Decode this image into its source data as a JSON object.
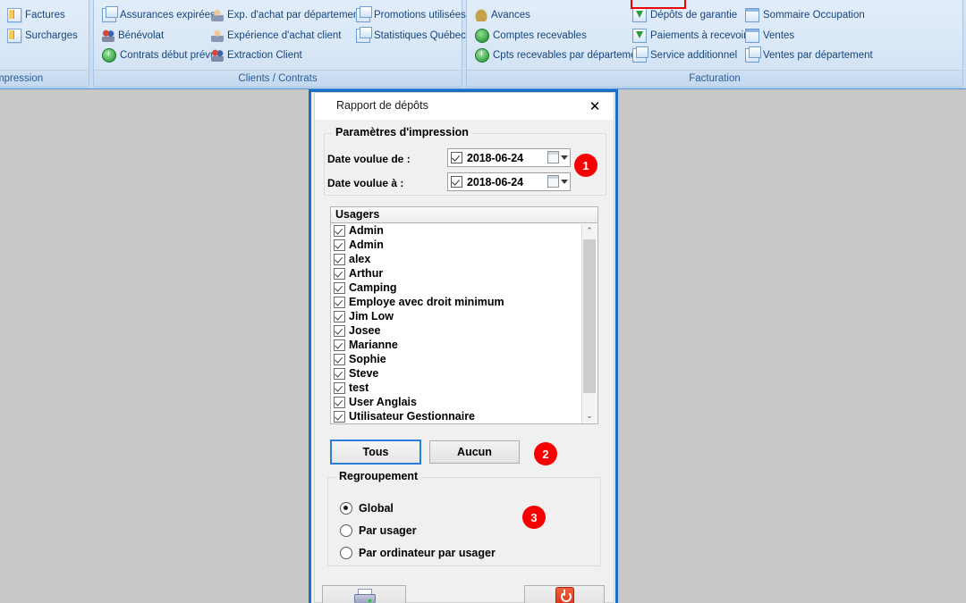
{
  "ribbon": {
    "groups": [
      {
        "name": "Impression",
        "items": [
          {
            "label": "Factures",
            "icon": "document-icon"
          },
          {
            "label": "Surcharges",
            "icon": "document-icon"
          }
        ]
      },
      {
        "name": "Clients / Contrats",
        "items": [
          {
            "label": "Assurances expirées",
            "icon": "window-stack-icon"
          },
          {
            "label": "Bénévolat",
            "icon": "people-icon"
          },
          {
            "label": "Contrats début prévu",
            "icon": "contract-icon"
          },
          {
            "label": "Exp. d'achat par département",
            "icon": "person-icon"
          },
          {
            "label": "Expérience d'achat client",
            "icon": "person-icon"
          },
          {
            "label": "Extraction Client",
            "icon": "people-icon"
          },
          {
            "label": "Promotions utilisées",
            "icon": "window-stack-icon"
          },
          {
            "label": "Statistiques Québec",
            "icon": "window-stack-icon"
          }
        ]
      },
      {
        "name": "Facturation",
        "items": [
          {
            "label": "Avances",
            "icon": "money-bag-icon"
          },
          {
            "label": "Comptes recevables",
            "icon": "green-coin-icon"
          },
          {
            "label": "Cpts recevables par département",
            "icon": "green-clock-icon"
          },
          {
            "label": "Dépôts de garantie",
            "icon": "download-window-icon"
          },
          {
            "label": "Paiements à recevoir",
            "icon": "download-window-icon"
          },
          {
            "label": "Service additionnel",
            "icon": "window-stack-icon"
          },
          {
            "label": "Sommaire Occupation",
            "icon": "window-icon"
          },
          {
            "label": "Ventes",
            "icon": "window-icon"
          },
          {
            "label": "Ventes par département",
            "icon": "window-stack-icon"
          }
        ]
      }
    ],
    "highlight_color": "#ee0000"
  },
  "dialog": {
    "title": "Rapport de dépôts",
    "close_label": "✕",
    "print_params": {
      "legend": "Paramètres d'impression",
      "date_from_label": "Date voulue de :",
      "date_from_value": "2018-06-24",
      "date_to_label": "Date voulue à :",
      "date_to_value": "2018-06-24"
    },
    "users_list": {
      "header": "Usagers",
      "items": [
        "Admin",
        "Admin",
        "alex",
        "Arthur",
        "Camping",
        "Employe avec droit minimum",
        "Jim Low",
        "Josee",
        "Marianne",
        "Sophie",
        "Steve",
        "test",
        "User Anglais",
        "Utilisateur Gestionnaire"
      ],
      "scroll_up": "⌃",
      "scroll_down": "⌄"
    },
    "select_buttons": {
      "all_label": "Tous",
      "none_label": "Aucun"
    },
    "grouping": {
      "legend": "Regroupement",
      "options": [
        {
          "label": "Global",
          "selected": true
        },
        {
          "label": "Par usager",
          "selected": false
        },
        {
          "label": "Par ordinateur par usager",
          "selected": false
        }
      ]
    },
    "actions": {
      "print_icon": "printer-icon",
      "exit_icon": "power-icon"
    },
    "badges": [
      {
        "number": "1"
      },
      {
        "number": "2"
      },
      {
        "number": "3"
      }
    ],
    "badge_color": "#f90000"
  }
}
